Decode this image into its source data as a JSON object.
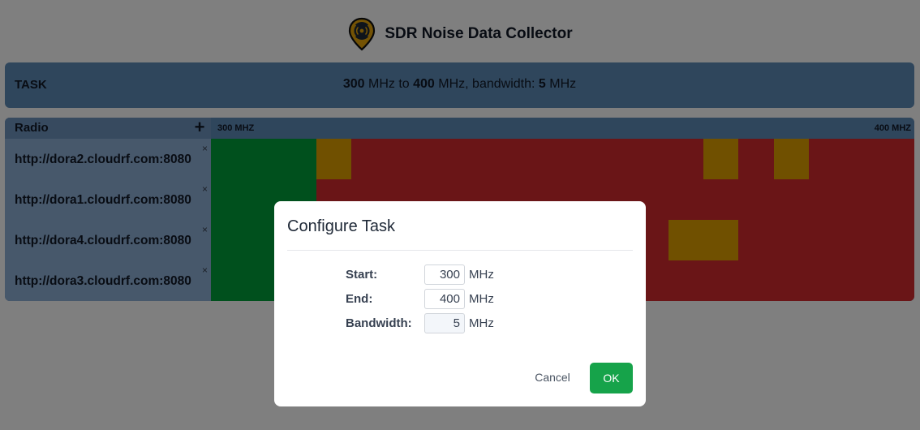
{
  "app": {
    "title": "SDR Noise Data Collector",
    "logo_icon": "radio-signal-pin-icon"
  },
  "task": {
    "label": "TASK",
    "start": "300",
    "mid1": " MHz to ",
    "end": "400",
    "mid2": " MHz, bandwidth: ",
    "bandwidth": "5",
    "tail": " MHz"
  },
  "grid": {
    "radio_header": "Radio",
    "add_icon": "plus-icon",
    "freq_start_label": "300 MHZ",
    "freq_end_label": "400 MHZ",
    "remove_icon": "close-icon",
    "radios": [
      {
        "url": "http://dora2.cloudrf.com:8080",
        "remove": "×"
      },
      {
        "url": "http://dora1.cloudrf.com:8080",
        "remove": "×"
      },
      {
        "url": "http://dora4.cloudrf.com:8080",
        "remove": "×"
      },
      {
        "url": "http://dora3.cloudrf.com:8080",
        "remove": "×"
      }
    ],
    "colors": {
      "quiet": "#00a13a",
      "moderate": "#e1a000",
      "noisy": "#d42a2f"
    }
  },
  "modal": {
    "title": "Configure Task",
    "start_label": "Start:",
    "start_value": "300",
    "end_label": "End:",
    "end_value": "400",
    "bandwidth_label": "Bandwidth:",
    "bandwidth_value": "5",
    "unit": "MHz",
    "cancel_label": "Cancel",
    "ok_label": "OK"
  }
}
